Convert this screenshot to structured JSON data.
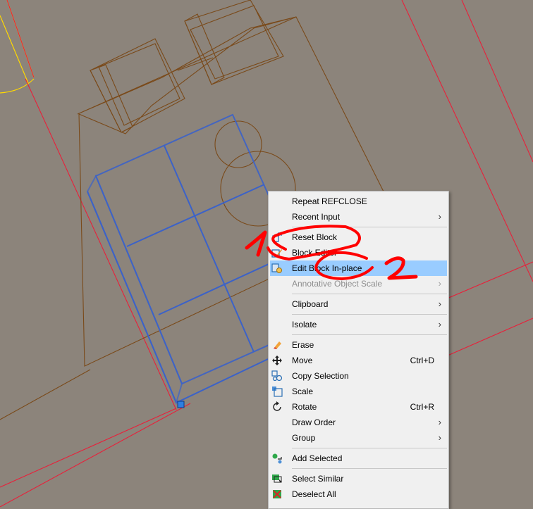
{
  "menu": {
    "items": [
      {
        "label": "Repeat REFCLOSE",
        "submenu": false
      },
      {
        "label": "Recent Input",
        "submenu": true
      },
      {
        "sep": true
      },
      {
        "label": "Reset Block",
        "icon": "reset-block-icon"
      },
      {
        "label": "Block Editor",
        "icon": "block-editor-icon"
      },
      {
        "label": "Edit Block In-place",
        "icon": "edit-block-in-place-icon",
        "highlighted": true
      },
      {
        "label": "Annotative Object Scale",
        "submenu": true,
        "disabled": true
      },
      {
        "sep": true
      },
      {
        "label": "Clipboard",
        "submenu": true
      },
      {
        "sep": true
      },
      {
        "label": "Isolate",
        "submenu": true
      },
      {
        "sep": true
      },
      {
        "label": "Erase",
        "icon": "eraser-icon"
      },
      {
        "label": "Move",
        "icon": "move-arrows-icon",
        "shortcut": "Ctrl+D"
      },
      {
        "label": "Copy Selection",
        "icon": "copy-selection-icon"
      },
      {
        "label": "Scale",
        "icon": "scale-icon"
      },
      {
        "label": "Rotate",
        "icon": "rotate-icon",
        "shortcut": "Ctrl+R"
      },
      {
        "label": "Draw Order",
        "submenu": true
      },
      {
        "label": "Group",
        "submenu": true
      },
      {
        "sep": true
      },
      {
        "label": "Add Selected",
        "icon": "add-selected-icon"
      },
      {
        "sep": true
      },
      {
        "label": "Select Similar",
        "icon": "select-similar-icon"
      },
      {
        "label": "Deselect All",
        "icon": "deselect-all-icon"
      }
    ],
    "submenu_glyph": "›"
  },
  "annotations": {
    "marker_1": "1",
    "marker_2": "2",
    "color": "#ff0000"
  },
  "colors": {
    "canvas_bg": "#8c847b",
    "furniture": "#7a4a1a",
    "selected_block": "#3b62c9",
    "boundary": "#e8203a",
    "door_arc": "#ffd800",
    "menu_highlight": "#99ccff"
  }
}
